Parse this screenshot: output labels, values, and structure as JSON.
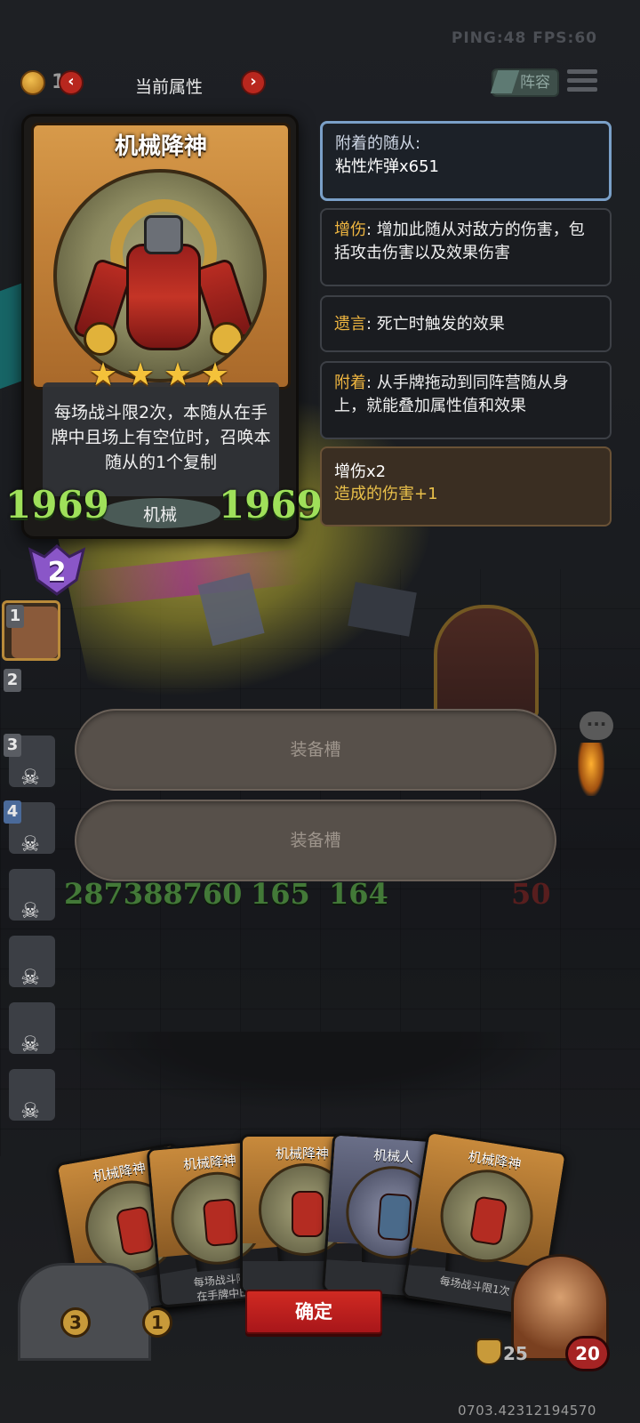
{
  "status": {
    "ping_fps": "PING:48 FPS:60"
  },
  "topbar": {
    "coins": "18",
    "title": "当前属性",
    "prev": "‹",
    "next": "›",
    "lineup": "阵容"
  },
  "card": {
    "name": "机械降神",
    "stars": 4,
    "description": "每场战斗限2次，本随从在手牌中且场上有空位时，召唤本随从的1个复制",
    "attack": "1969",
    "health": "1969",
    "tribe": "机械",
    "level": "2"
  },
  "info": {
    "attached_title": "附着的随从:",
    "attached_content": "粘性炸弹x651",
    "dmg_keyword": "增伤",
    "dmg_text": ": 增加此随从对敌方的伤害，包括攻击伤害以及效果伤害",
    "deathrattle_keyword": "遗言",
    "deathrattle_text": ": 死亡时触发的效果",
    "attach_keyword": "附着",
    "attach_text": ": 从手牌拖动到同阵营随从身上，就能叠加属性值和效果",
    "buff_title": "增伤x2",
    "buff_desc": "造成的伤害+1"
  },
  "sidebar": {
    "slots": [
      "1",
      "2",
      "3",
      "4"
    ]
  },
  "board": {
    "stat1": "28738",
    "stat1b": "8760",
    "stat2": "165",
    "stat3": "164",
    "stat4": "50"
  },
  "equip": {
    "slot1": "装备槽",
    "slot2": "装备槽"
  },
  "hand": {
    "card1_name": "机械降神",
    "card2_name": "机械降神",
    "card3_name": "机械降神",
    "card4_name": "机械人",
    "card5_name": "机械降神",
    "card_desc_short1": "每场战斗限",
    "card_desc_short2": "在手牌中E",
    "card_desc_short5": "每场战斗限1次"
  },
  "confirm": "确定",
  "bottom": {
    "gold_left": "3",
    "gold_right": "1",
    "armor": "25",
    "hp": "20",
    "seed": "0703.42312194570"
  }
}
